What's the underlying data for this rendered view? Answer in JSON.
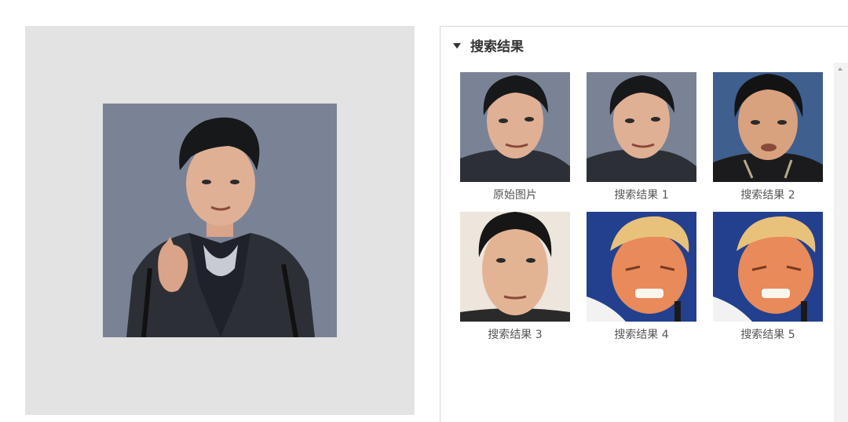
{
  "panel": {
    "title": "搜索结果",
    "collapse_icon": "caret-down-icon"
  },
  "source_image": {
    "label": "原始图片"
  },
  "results": [
    {
      "label": "原始图片"
    },
    {
      "label": "搜索结果 1"
    },
    {
      "label": "搜索结果 2"
    },
    {
      "label": "搜索结果 3"
    },
    {
      "label": "搜索结果 4"
    },
    {
      "label": "搜索结果 5"
    }
  ],
  "colors": {
    "image_panel_bg": "#e3e3e3",
    "photo_bg": "#7a8396",
    "scrollbar_track": "#f2f2f2"
  }
}
